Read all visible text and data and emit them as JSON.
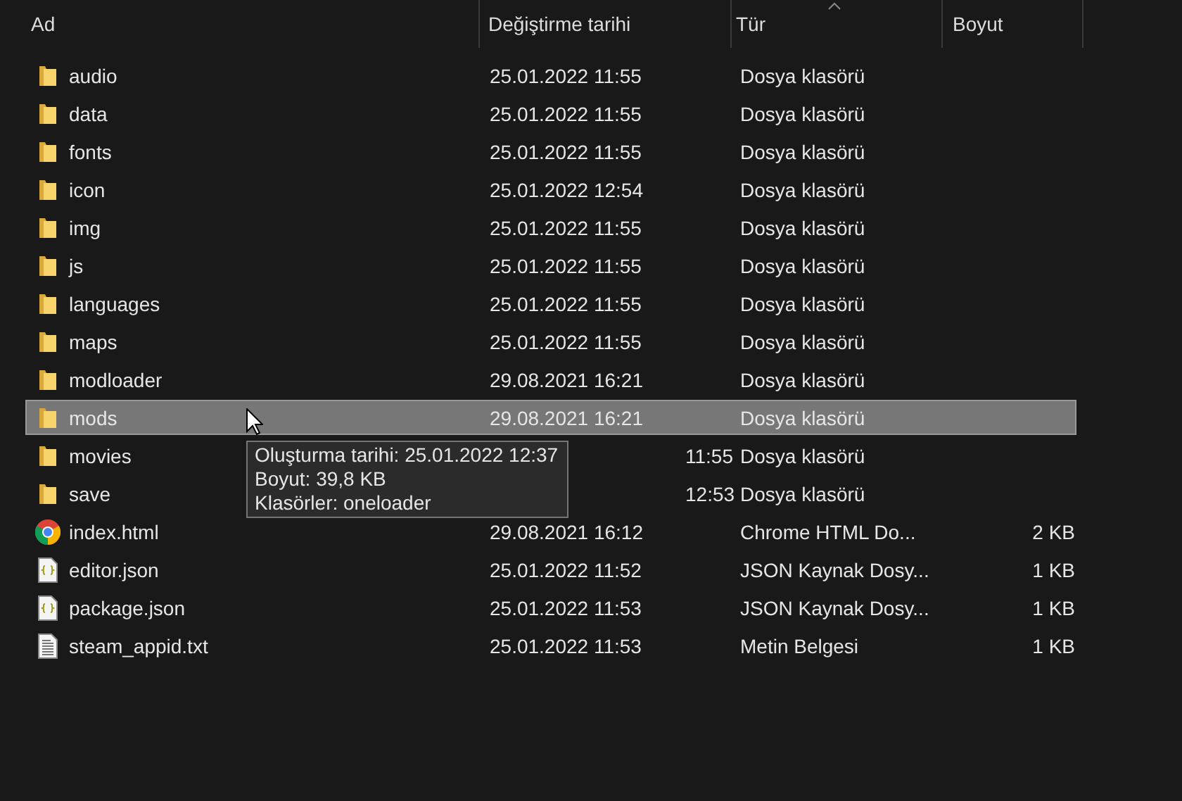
{
  "columns": [
    {
      "label": "Ad",
      "sorted": false
    },
    {
      "label": "Değiştirme tarihi",
      "sorted": false
    },
    {
      "label": "Tür",
      "sorted": true
    },
    {
      "label": "Boyut",
      "sorted": false
    }
  ],
  "rows": [
    {
      "kind": "folder",
      "name": "audio",
      "date": "25.01.2022 11:55",
      "type": "Dosya klasörü",
      "selected": false
    },
    {
      "kind": "folder",
      "name": "data",
      "date": "25.01.2022 11:55",
      "type": "Dosya klasörü",
      "selected": false
    },
    {
      "kind": "folder",
      "name": "fonts",
      "date": "25.01.2022 11:55",
      "type": "Dosya klasörü",
      "selected": false
    },
    {
      "kind": "folder",
      "name": "icon",
      "date": "25.01.2022 12:54",
      "type": "Dosya klasörü",
      "selected": false
    },
    {
      "kind": "folder",
      "name": "img",
      "date": "25.01.2022 11:55",
      "type": "Dosya klasörü",
      "selected": false
    },
    {
      "kind": "folder",
      "name": "js",
      "date": "25.01.2022 11:55",
      "type": "Dosya klasörü",
      "selected": false
    },
    {
      "kind": "folder",
      "name": "languages",
      "date": "25.01.2022 11:55",
      "type": "Dosya klasörü",
      "selected": false
    },
    {
      "kind": "folder",
      "name": "maps",
      "date": "25.01.2022 11:55",
      "type": "Dosya klasörü",
      "selected": false
    },
    {
      "kind": "folder",
      "name": "modloader",
      "date": "29.08.2021 16:21",
      "type": "Dosya klasörü",
      "selected": false
    },
    {
      "kind": "folder",
      "name": "mods",
      "date": "29.08.2021 16:21",
      "type": "Dosya klasörü",
      "selected": true,
      "tooltip": [
        "Oluşturma tarihi: 25.01.2022 12:37",
        "Boyut: 39,8 KB",
        "Klasörler: oneloader"
      ]
    },
    {
      "kind": "folder",
      "name": "movies",
      "date_visible_part": "11:55",
      "type": "Dosya klasörü",
      "selected": false
    },
    {
      "kind": "folder",
      "name": "save",
      "date_visible_part": "12:53",
      "type": "Dosya klasörü",
      "selected": false
    },
    {
      "kind": "chrome",
      "name": "index.html",
      "date": "29.08.2021 16:12",
      "type": "Chrome HTML Do...",
      "size": "2 KB",
      "selected": false
    },
    {
      "kind": "json",
      "name": "editor.json",
      "date": "25.01.2022 11:52",
      "type": "JSON Kaynak Dosy...",
      "size": "1 KB",
      "selected": false
    },
    {
      "kind": "json",
      "name": "package.json",
      "date": "25.01.2022 11:53",
      "type": "JSON Kaynak Dosy...",
      "size": "1 KB",
      "selected": false
    },
    {
      "kind": "text",
      "name": "steam_appid.txt",
      "date": "25.01.2022 11:53",
      "type": "Metin Belgesi",
      "size": "1 KB",
      "selected": false
    }
  ]
}
